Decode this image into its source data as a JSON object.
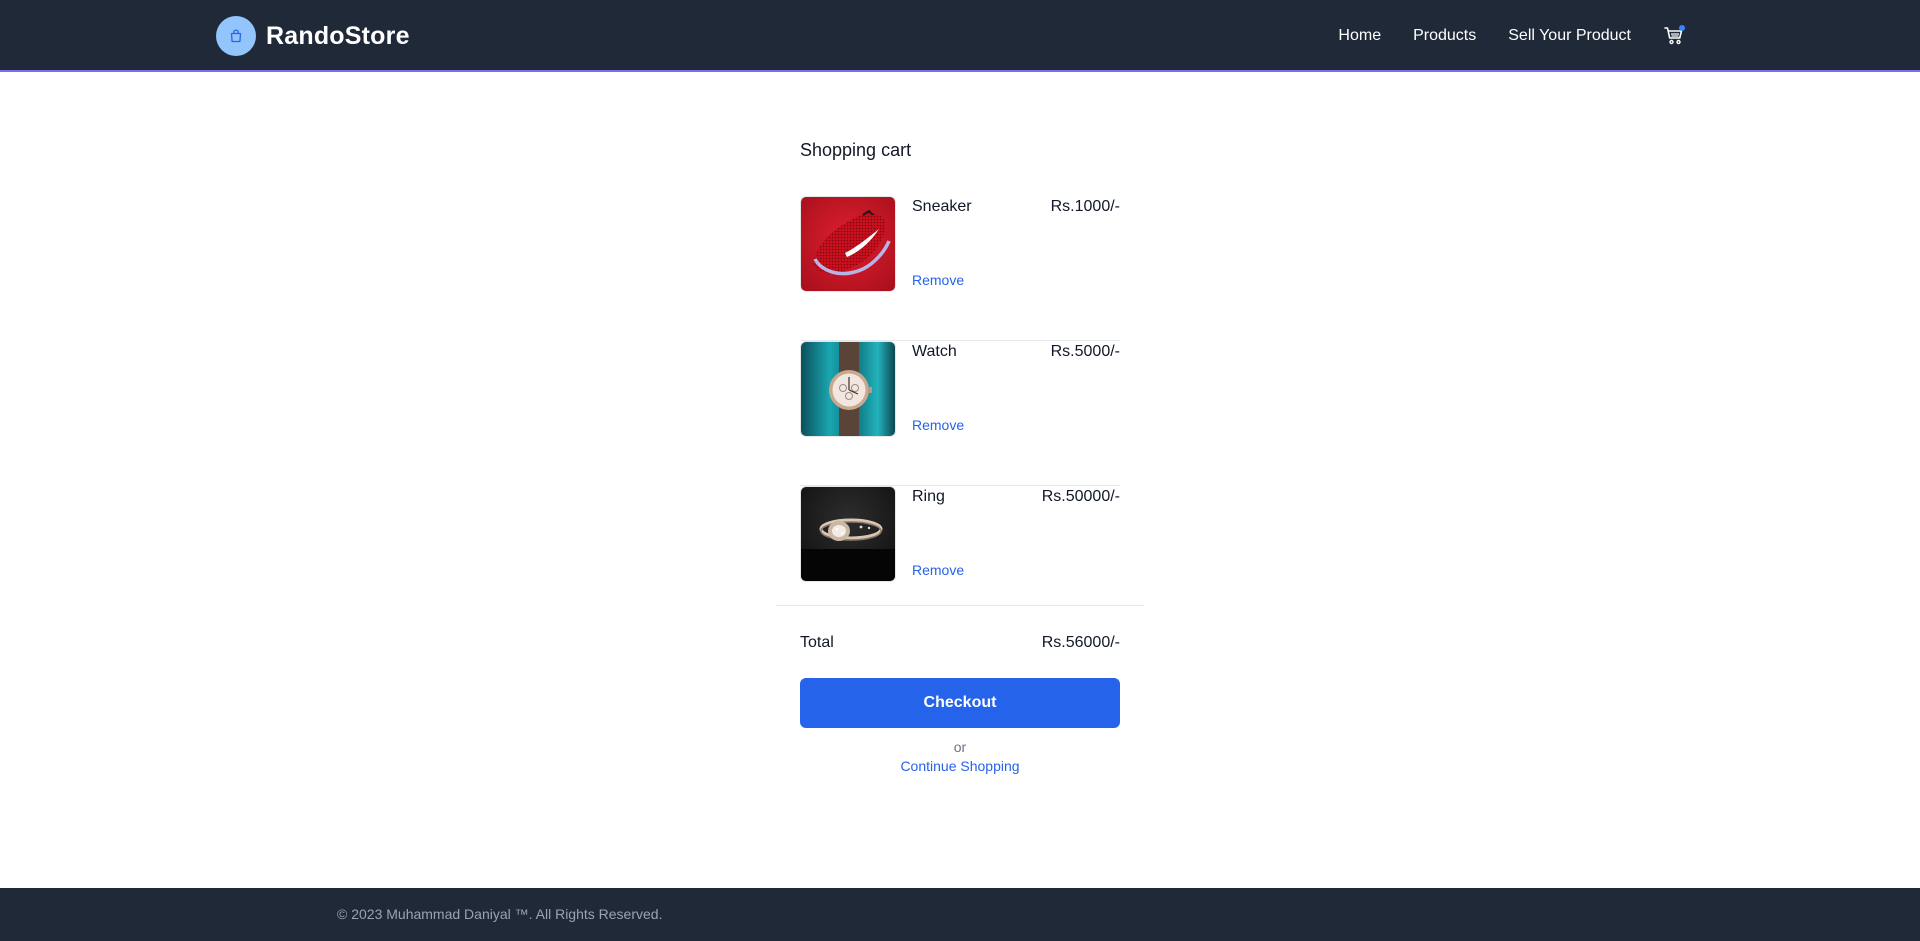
{
  "header": {
    "brand": "RandoStore",
    "nav": [
      {
        "label": "Home"
      },
      {
        "label": "Products"
      },
      {
        "label": "Sell Your Product"
      }
    ],
    "cart_icon": "cart-icon",
    "brand_icon": "shopping-bag-icon",
    "colors": {
      "bar": "#1f2937",
      "accent_line": "#7c6cf0",
      "logo_bg": "#93c5fd"
    }
  },
  "cart": {
    "title": "Shopping cart",
    "items": [
      {
        "name": "Sneaker",
        "price": "Rs.1000/-",
        "remove_label": "Remove",
        "image": "red-sneaker-photo"
      },
      {
        "name": "Watch",
        "price": "Rs.5000/-",
        "remove_label": "Remove",
        "image": "wristwatch-photo"
      },
      {
        "name": "Ring",
        "price": "Rs.50000/-",
        "remove_label": "Remove",
        "image": "diamond-ring-photo"
      }
    ],
    "total_label": "Total",
    "total_value": "Rs.56000/-",
    "checkout_label": "Checkout",
    "or_text": "or",
    "continue_label": "Continue Shopping",
    "colors": {
      "primary": "#2563eb"
    }
  },
  "footer": {
    "text": "© 2023 Muhammad Daniyal ™. All Rights Reserved."
  }
}
